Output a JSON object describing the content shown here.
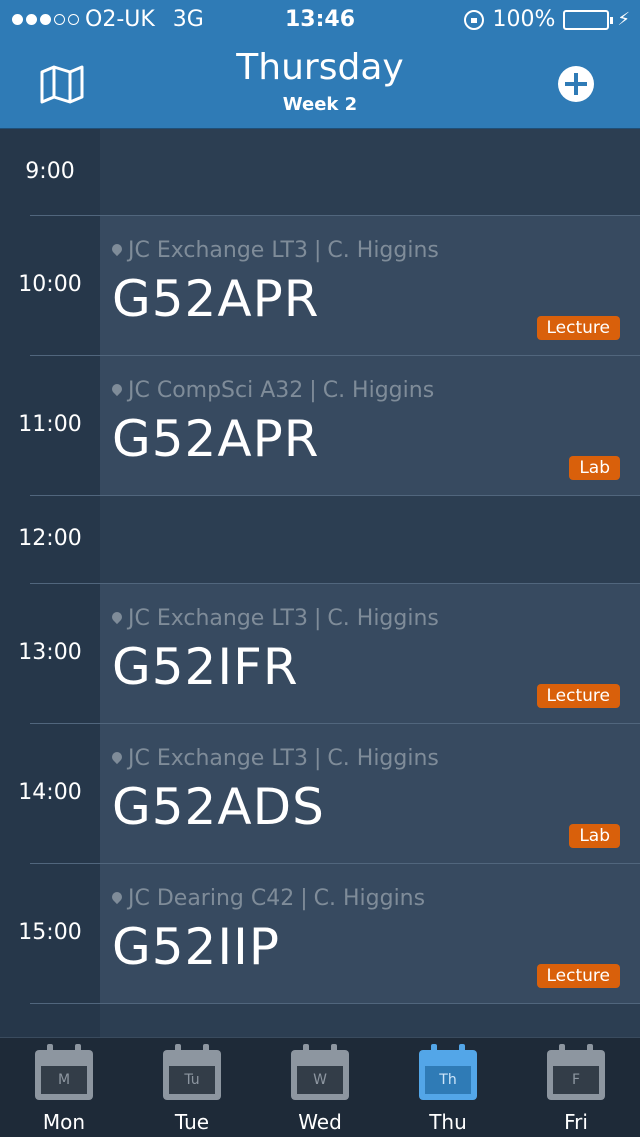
{
  "status_bar": {
    "carrier": "O2-UK",
    "network": "3G",
    "time": "13:46",
    "battery": "100%",
    "battery_level": 1.0
  },
  "header": {
    "title": "Thursday",
    "subtitle": "Week 2",
    "left_icon": "map-icon",
    "right_icon": "add-icon"
  },
  "schedule": [
    {
      "time": "9:00"
    },
    {
      "time": "10:00",
      "location": "JC Exchange LT3",
      "separator": "|",
      "lecturer": "C. Higgins",
      "code": "G52APR",
      "type": "Lecture"
    },
    {
      "time": "11:00",
      "location": "JC CompSci A32",
      "separator": "|",
      "lecturer": "C. Higgins",
      "code": "G52APR",
      "type": "Lab"
    },
    {
      "time": "12:00"
    },
    {
      "time": "13:00",
      "location": "JC Exchange LT3",
      "separator": "|",
      "lecturer": "C. Higgins",
      "code": "G52IFR",
      "type": "Lecture"
    },
    {
      "time": "14:00",
      "location": "JC Exchange LT3",
      "separator": "|",
      "lecturer": "C. Higgins",
      "code": "G52ADS",
      "type": "Lab"
    },
    {
      "time": "15:00",
      "location": "JC Dearing C42",
      "separator": "|",
      "lecturer": "C. Higgins",
      "code": "G52IIP",
      "type": "Lecture"
    }
  ],
  "tabs": [
    {
      "label": "Mon",
      "abbr": "M",
      "active": false
    },
    {
      "label": "Tue",
      "abbr": "Tu",
      "active": false
    },
    {
      "label": "Wed",
      "abbr": "W",
      "active": false
    },
    {
      "label": "Thu",
      "abbr": "Th",
      "active": true
    },
    {
      "label": "Fri",
      "abbr": "F",
      "active": false
    }
  ],
  "colors": {
    "header": "#2f7bb6",
    "badge": "#d9600b",
    "active_tab": "#53a6e8"
  }
}
